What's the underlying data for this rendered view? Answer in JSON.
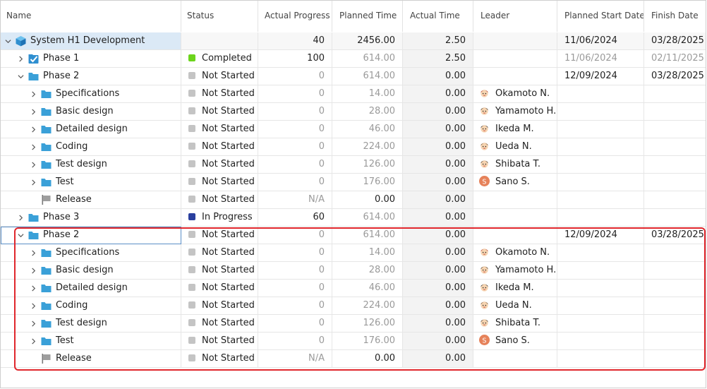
{
  "columns": [
    "Name",
    "Status",
    "Actual Progress",
    "Planned Time",
    "Actual Time",
    "Leader",
    "Planned Start Date",
    "Finish Date"
  ],
  "colors": {
    "completed": "#6cd41c",
    "not_started": "#c4c4c4",
    "in_progress": "#2a3f9e",
    "folder": "#3aa0d8",
    "selection": "#dbe9f6",
    "highlight_border": "#e0262c"
  },
  "rows": [
    {
      "level": 0,
      "expanded": true,
      "icon": "cube-icon",
      "name": "System H1 Development",
      "status": "",
      "progress": "40",
      "planned": "2456.00",
      "actual": "2.50",
      "leader": "",
      "avatar": "",
      "start": "11/06/2024",
      "finish": "03/28/2025"
    },
    {
      "level": 1,
      "expanded": false,
      "icon": "task-done-icon",
      "name": "Phase 1",
      "status": "Completed",
      "progress": "100",
      "planned": "614.00",
      "actual": "2.50",
      "leader": "",
      "avatar": "",
      "start": "11/06/2024",
      "finish": "02/11/2025",
      "dates_muted": true
    },
    {
      "level": 1,
      "expanded": true,
      "icon": "folder-icon",
      "name": "Phase 2",
      "status": "Not Started",
      "progress": "0",
      "planned": "614.00",
      "actual": "0.00",
      "leader": "",
      "avatar": "",
      "start": "12/09/2024",
      "finish": "03/28/2025"
    },
    {
      "level": 2,
      "expanded": false,
      "icon": "folder-icon",
      "name": "Specifications",
      "status": "Not Started",
      "progress": "0",
      "planned": "14.00",
      "actual": "0.00",
      "leader": "Okamoto N.",
      "avatar": "avatar-okamoto",
      "start": "",
      "finish": ""
    },
    {
      "level": 2,
      "expanded": false,
      "icon": "folder-icon",
      "name": "Basic design",
      "status": "Not Started",
      "progress": "0",
      "planned": "28.00",
      "actual": "0.00",
      "leader": "Yamamoto H.",
      "avatar": "avatar-yamamoto",
      "start": "",
      "finish": ""
    },
    {
      "level": 2,
      "expanded": false,
      "icon": "folder-icon",
      "name": "Detailed design",
      "status": "Not Started",
      "progress": "0",
      "planned": "46.00",
      "actual": "0.00",
      "leader": "Ikeda M.",
      "avatar": "avatar-ikeda",
      "start": "",
      "finish": ""
    },
    {
      "level": 2,
      "expanded": false,
      "icon": "folder-icon",
      "name": "Coding",
      "status": "Not Started",
      "progress": "0",
      "planned": "224.00",
      "actual": "0.00",
      "leader": "Ueda N.",
      "avatar": "avatar-ueda",
      "start": "",
      "finish": ""
    },
    {
      "level": 2,
      "expanded": false,
      "icon": "folder-icon",
      "name": "Test design",
      "status": "Not Started",
      "progress": "0",
      "planned": "126.00",
      "actual": "0.00",
      "leader": "Shibata T.",
      "avatar": "avatar-shibata",
      "start": "",
      "finish": ""
    },
    {
      "level": 2,
      "expanded": false,
      "icon": "folder-icon",
      "name": "Test",
      "status": "Not Started",
      "progress": "0",
      "planned": "176.00",
      "actual": "0.00",
      "leader": "Sano S.",
      "avatar": "avatar-sano",
      "avatar_letter": "S",
      "start": "",
      "finish": ""
    },
    {
      "level": 2,
      "expanded": null,
      "icon": "flag-icon",
      "name": "Release",
      "status": "Not Started",
      "progress": "N/A",
      "planned": "0.00",
      "actual": "0.00",
      "leader": "",
      "avatar": "",
      "start": "",
      "finish": "",
      "planned_dark": true
    },
    {
      "level": 1,
      "expanded": false,
      "icon": "folder-icon",
      "name": "Phase 3",
      "status": "In Progress",
      "progress": "60",
      "planned": "614.00",
      "actual": "0.00",
      "leader": "",
      "avatar": "",
      "start": "",
      "finish": ""
    },
    {
      "level": 1,
      "expanded": true,
      "icon": "folder-icon",
      "name": "Phase 2",
      "status": "Not Started",
      "progress": "0",
      "planned": "614.00",
      "actual": "0.00",
      "leader": "",
      "avatar": "",
      "start": "12/09/2024",
      "finish": "03/28/2025",
      "focused": true
    },
    {
      "level": 2,
      "expanded": false,
      "icon": "folder-icon",
      "name": "Specifications",
      "status": "Not Started",
      "progress": "0",
      "planned": "14.00",
      "actual": "0.00",
      "leader": "Okamoto N.",
      "avatar": "avatar-okamoto",
      "start": "",
      "finish": ""
    },
    {
      "level": 2,
      "expanded": false,
      "icon": "folder-icon",
      "name": "Basic design",
      "status": "Not Started",
      "progress": "0",
      "planned": "28.00",
      "actual": "0.00",
      "leader": "Yamamoto H.",
      "avatar": "avatar-yamamoto",
      "start": "",
      "finish": ""
    },
    {
      "level": 2,
      "expanded": false,
      "icon": "folder-icon",
      "name": "Detailed design",
      "status": "Not Started",
      "progress": "0",
      "planned": "46.00",
      "actual": "0.00",
      "leader": "Ikeda M.",
      "avatar": "avatar-ikeda",
      "start": "",
      "finish": ""
    },
    {
      "level": 2,
      "expanded": false,
      "icon": "folder-icon",
      "name": "Coding",
      "status": "Not Started",
      "progress": "0",
      "planned": "224.00",
      "actual": "0.00",
      "leader": "Ueda N.",
      "avatar": "avatar-ueda",
      "start": "",
      "finish": ""
    },
    {
      "level": 2,
      "expanded": false,
      "icon": "folder-icon",
      "name": "Test design",
      "status": "Not Started",
      "progress": "0",
      "planned": "126.00",
      "actual": "0.00",
      "leader": "Shibata T.",
      "avatar": "avatar-shibata",
      "start": "",
      "finish": ""
    },
    {
      "level": 2,
      "expanded": false,
      "icon": "folder-icon",
      "name": "Test",
      "status": "Not Started",
      "progress": "0",
      "planned": "176.00",
      "actual": "0.00",
      "leader": "Sano S.",
      "avatar": "avatar-sano",
      "avatar_letter": "S",
      "start": "",
      "finish": ""
    },
    {
      "level": 2,
      "expanded": null,
      "icon": "flag-icon",
      "name": "Release",
      "status": "Not Started",
      "progress": "N/A",
      "planned": "0.00",
      "actual": "0.00",
      "leader": "",
      "avatar": "",
      "start": "",
      "finish": "",
      "planned_dark": true
    }
  ]
}
